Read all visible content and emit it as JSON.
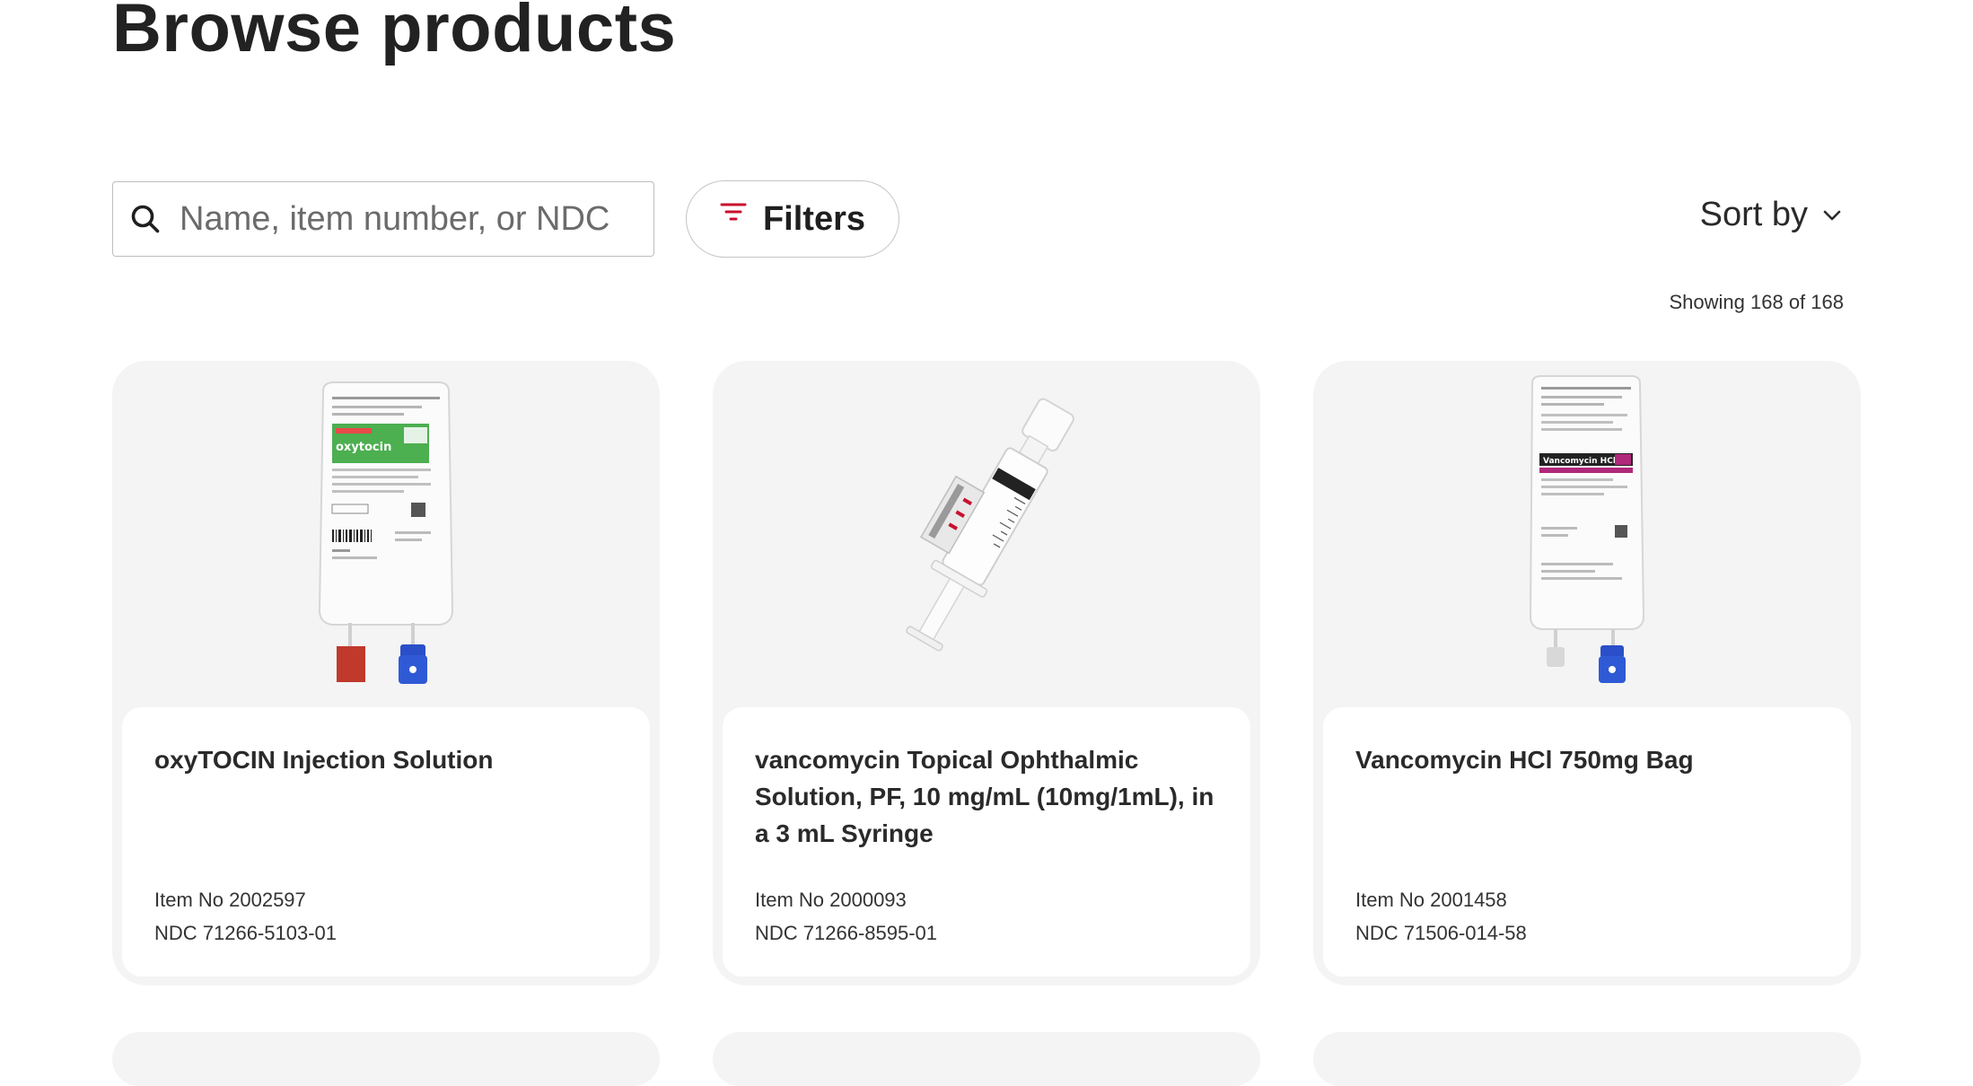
{
  "page": {
    "title": "Browse products"
  },
  "search": {
    "placeholder": "Name, item number, or NDC"
  },
  "toolbar": {
    "filters_label": "Filters",
    "sort_label": "Sort by",
    "showing_text": "Showing 168 of 168"
  },
  "products": [
    {
      "name": "oxyTOCIN Injection Solution",
      "item_no": "Item No 2002597",
      "ndc": "NDC 71266-5103-01",
      "image_icon": "iv-bag-icon"
    },
    {
      "name": "vancomycin Topical Ophthalmic Solution, PF, 10 mg/mL (10mg/1mL), in a 3 mL Syringe",
      "item_no": "Item No 2000093",
      "ndc": "NDC 71266-8595-01",
      "image_icon": "syringe-icon"
    },
    {
      "name": "Vancomycin HCl 750mg Bag",
      "item_no": "Item No 2001458",
      "ndc": "NDC 71506-014-58",
      "image_icon": "iv-bag-icon"
    }
  ],
  "colors": {
    "accent_red": "#c8102e",
    "card_bg": "#f4f4f4",
    "label_green": "#4caf50",
    "label_magenta": "#b0287a",
    "port_blue": "#2a4fc9"
  }
}
